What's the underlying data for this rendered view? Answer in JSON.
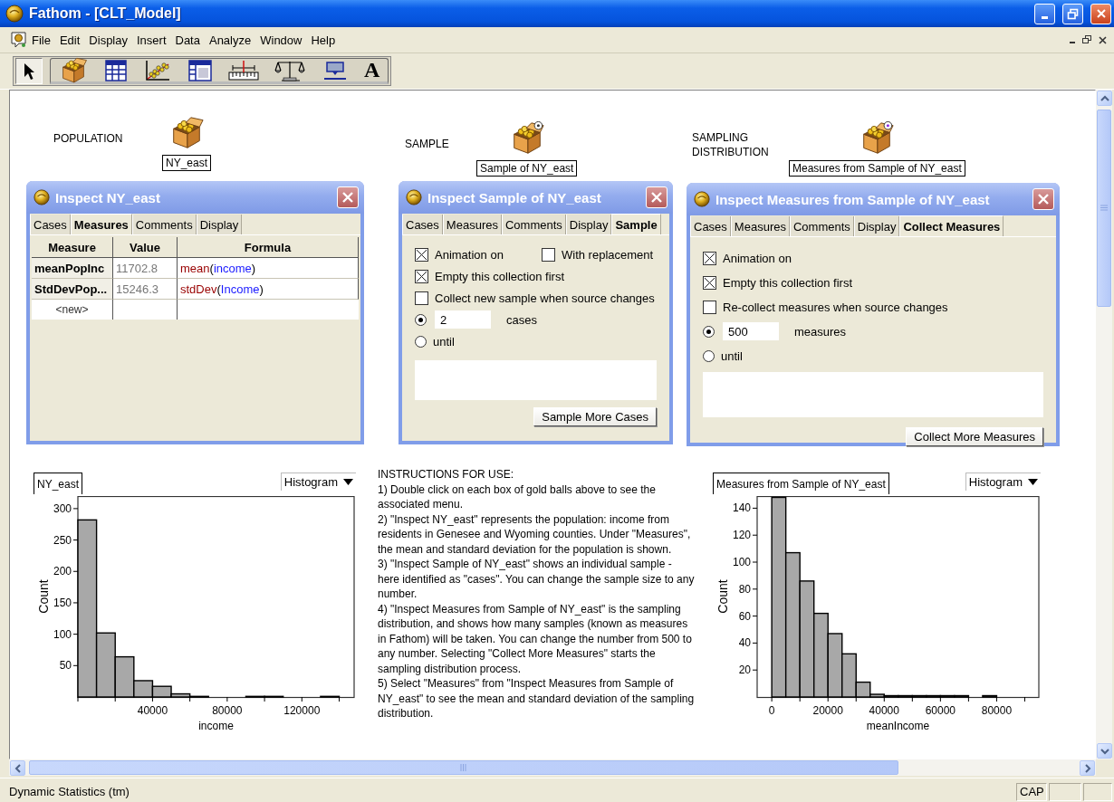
{
  "window": {
    "title": "Fathom - [CLT_Model]"
  },
  "menu": [
    "File",
    "Edit",
    "Display",
    "Insert",
    "Data",
    "Analyze",
    "Window",
    "Help"
  ],
  "toolbar": {
    "tools": [
      {
        "kind": "pointer",
        "selected": true
      },
      {
        "kind": "collection",
        "selected": false
      },
      {
        "kind": "table",
        "selected": false
      },
      {
        "kind": "graph",
        "selected": false
      },
      {
        "kind": "summary",
        "selected": false
      },
      {
        "kind": "slider",
        "selected": false
      },
      {
        "kind": "test",
        "selected": false
      },
      {
        "kind": "estimate",
        "selected": false
      },
      {
        "kind": "text",
        "selected": false,
        "glyph": "A"
      }
    ]
  },
  "document": {
    "labels": [
      {
        "text": "POPULATION"
      },
      {
        "text": "SAMPLE"
      },
      {
        "text": "SAMPLING DISTRIBUTION"
      }
    ],
    "collections": [
      {
        "name": "NY_east",
        "kind": "population"
      },
      {
        "name": "Sample of NY_east",
        "kind": "sample"
      },
      {
        "name": "Measures from Sample of NY_east",
        "kind": "measures"
      }
    ],
    "inspectors": [
      {
        "title": "Inspect NY_east",
        "tabs": [
          {
            "label": "Cases",
            "selected": false
          },
          {
            "label": "Measures",
            "selected": true
          },
          {
            "label": "Comments",
            "selected": false
          },
          {
            "label": "Display",
            "selected": false
          }
        ],
        "pane": {
          "kind": "measures",
          "columns": [
            "Measure",
            "Value",
            "Formula"
          ],
          "rows": [
            {
              "kind": "measure",
              "measure": "meanPopInc",
              "value": "11702.8",
              "formula": [
                {
                  "kind": "function",
                  "text": "mean"
                },
                {
                  "kind": "punct",
                  "text": "("
                },
                {
                  "kind": "attribute",
                  "text": "income"
                },
                {
                  "kind": "punct",
                  "text": ")"
                }
              ]
            },
            {
              "kind": "measure",
              "measure": "StdDevPop...",
              "value": "15246.3",
              "formula": [
                {
                  "kind": "function",
                  "text": "stdDev"
                },
                {
                  "kind": "punct",
                  "text": "("
                },
                {
                  "kind": "attribute",
                  "text": "Income"
                },
                {
                  "kind": "punct",
                  "text": ")"
                }
              ]
            },
            {
              "kind": "new",
              "measure": "<new>"
            }
          ]
        }
      },
      {
        "title": "Inspect Sample of NY_east",
        "tabs": [
          {
            "label": "Cases",
            "selected": false
          },
          {
            "label": "Measures",
            "selected": false
          },
          {
            "label": "Comments",
            "selected": false
          },
          {
            "label": "Display",
            "selected": false
          },
          {
            "label": "Sample",
            "selected": true
          }
        ],
        "pane": {
          "kind": "options",
          "rows": [
            {
              "items": [
                {
                  "kind": "checkbox",
                  "label": "Animation on",
                  "checked": true
                },
                {
                  "kind": "checkbox",
                  "label": "With replacement",
                  "checked": false
                }
              ]
            },
            {
              "items": [
                {
                  "kind": "checkbox",
                  "label": "Empty this collection first",
                  "checked": true
                }
              ]
            },
            {
              "items": [
                {
                  "kind": "checkbox",
                  "label": "Collect new sample when source changes",
                  "checked": false
                }
              ]
            },
            {
              "items": [
                {
                  "kind": "radio",
                  "selected": true,
                  "value": "2",
                  "unit": "cases"
                }
              ]
            },
            {
              "items": [
                {
                  "kind": "radio",
                  "selected": false,
                  "label": "until"
                }
              ]
            }
          ],
          "button": "Sample More Cases"
        }
      },
      {
        "title": "Inspect Measures from Sample of NY_east",
        "tabs": [
          {
            "label": "Cases",
            "selected": false
          },
          {
            "label": "Measures",
            "selected": false
          },
          {
            "label": "Comments",
            "selected": false
          },
          {
            "label": "Display",
            "selected": false
          },
          {
            "label": "Collect Measures",
            "selected": true
          }
        ],
        "pane": {
          "kind": "options",
          "rows": [
            {
              "items": [
                {
                  "kind": "checkbox",
                  "label": "Animation on",
                  "checked": true
                }
              ]
            },
            {
              "items": [
                {
                  "kind": "checkbox",
                  "label": "Empty this collection first",
                  "checked": true
                }
              ]
            },
            {
              "items": [
                {
                  "kind": "checkbox",
                  "label": "Re-collect measures when source changes",
                  "checked": false
                }
              ]
            },
            {
              "items": [
                {
                  "kind": "radio",
                  "selected": true,
                  "value": "500",
                  "unit": "measures"
                }
              ]
            },
            {
              "items": [
                {
                  "kind": "radio",
                  "selected": false,
                  "label": "until"
                }
              ]
            }
          ],
          "button": "Collect More Measures"
        }
      }
    ],
    "graphs": [
      {
        "title": "NY_east",
        "plot_type": "Histogram",
        "chart_data": {
          "type": "bar",
          "xlabel": "income",
          "ylabel": "Count",
          "x": [
            5000,
            15000,
            25000,
            35000,
            45000,
            55000,
            65000,
            95000,
            105000,
            135000
          ],
          "values": [
            282,
            102,
            64,
            26,
            17,
            5,
            1,
            1,
            1,
            1
          ],
          "xlim": [
            0,
            148000
          ],
          "ylim": [
            0,
            320
          ],
          "xticks": [
            40000,
            80000,
            120000
          ],
          "yticks": [
            50,
            100,
            150,
            200,
            250,
            300
          ]
        }
      },
      {
        "title": "Measures from Sample of NY_east",
        "plot_type": "Histogram",
        "chart_data": {
          "type": "bar",
          "xlabel": "meanIncome",
          "ylabel": "Count",
          "x": [
            2500,
            7500,
            12500,
            17500,
            22500,
            27500,
            32500,
            37500,
            42500,
            47500,
            52500,
            57500,
            62500,
            67500,
            77500
          ],
          "values": [
            148,
            107,
            86,
            62,
            47,
            32,
            11,
            2,
            1,
            1,
            1,
            1,
            1,
            1,
            1
          ],
          "xlim": [
            -5200,
            95000
          ],
          "ylim": [
            0,
            149
          ],
          "xticks": [
            0,
            20000,
            40000,
            60000,
            80000
          ],
          "yticks": [
            20,
            40,
            60,
            80,
            100,
            120,
            140
          ]
        }
      }
    ],
    "instructions": {
      "heading": "INSTRUCTIONS FOR USE:",
      "items": [
        "1) Double click on each box of gold balls above to see the associated menu.",
        "2) \"Inspect NY_east\" represents the population: income from residents in Genesee and Wyoming counties. Under \"Measures\", the mean and standard deviation for the population is shown.",
        "3) \"Inspect Sample of NY_east\" shows an individual sample - here identified as \"cases\". You can change the sample size to any number.",
        "4) \"Inspect Measures from Sample of NY_east\" is the sampling distribution, and shows how many samples (known as measures in Fathom) will be taken. You can change the number from 500 to any number. Selecting \"Collect More Measures\" starts the sampling distribution process.",
        "5) Select \"Measures\" from \"Inspect Measures from Sample of NY_east\" to see the mean and standard deviation of the sampling distribution."
      ]
    }
  },
  "status_bar": {
    "text": "Dynamic Statistics (tm)",
    "indicators": [
      "CAP"
    ]
  }
}
